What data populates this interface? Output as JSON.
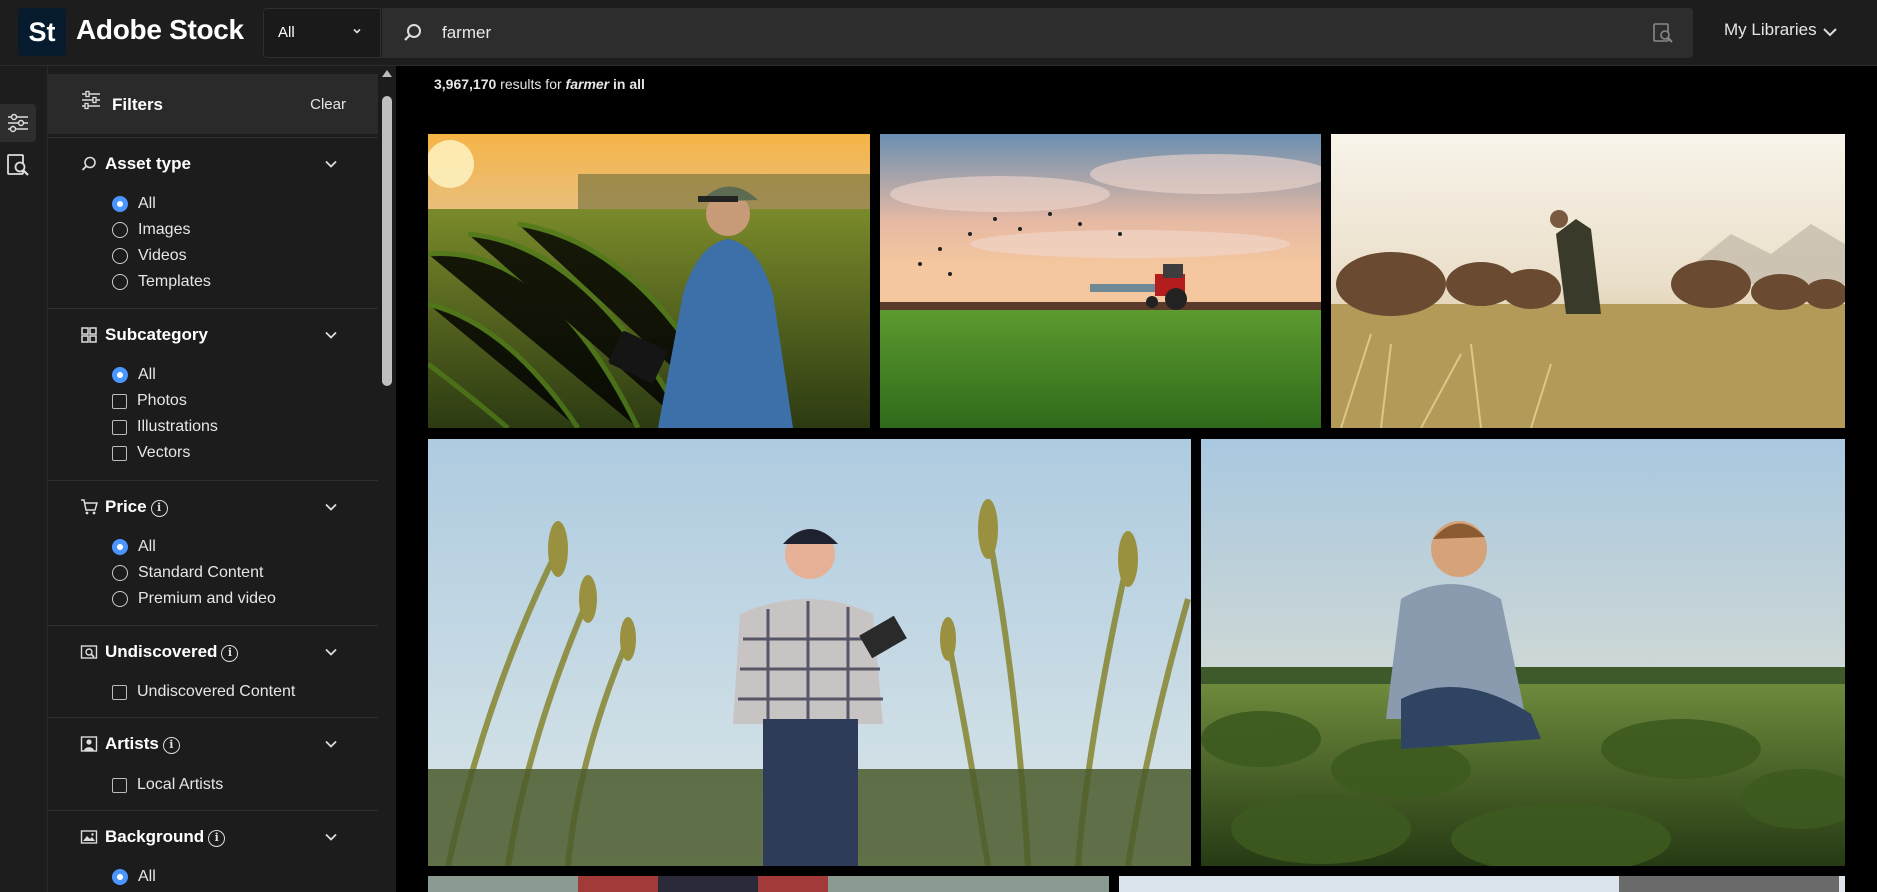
{
  "header": {
    "logo_text": "St",
    "brand": "Adobe Stock",
    "scope_value": "All",
    "search_value": "farmer",
    "my_libraries": "My Libraries"
  },
  "filters": {
    "title": "Filters",
    "clear": "Clear",
    "asset_type": {
      "title": "Asset type",
      "options": [
        "All",
        "Images",
        "Videos",
        "Templates"
      ],
      "selected": "All"
    },
    "subcategory": {
      "title": "Subcategory",
      "options": [
        "All",
        "Photos",
        "Illustrations",
        "Vectors"
      ],
      "selected": "All"
    },
    "price": {
      "title": "Price",
      "options": [
        "All",
        "Standard Content",
        "Premium and video"
      ],
      "selected": "All"
    },
    "undiscovered": {
      "title": "Undiscovered",
      "options": [
        "Undiscovered Content"
      ]
    },
    "artists": {
      "title": "Artists",
      "options": [
        "Local Artists"
      ]
    },
    "background": {
      "title": "Background",
      "options": [
        "All"
      ],
      "selected": "All"
    }
  },
  "results": {
    "count": "3,967,170",
    "pre": " results for ",
    "term": "farmer",
    "post": " in all"
  },
  "colors": {
    "accent": "#4b95ff",
    "panel": "#1c1c1c",
    "header": "#1d1d1d"
  }
}
